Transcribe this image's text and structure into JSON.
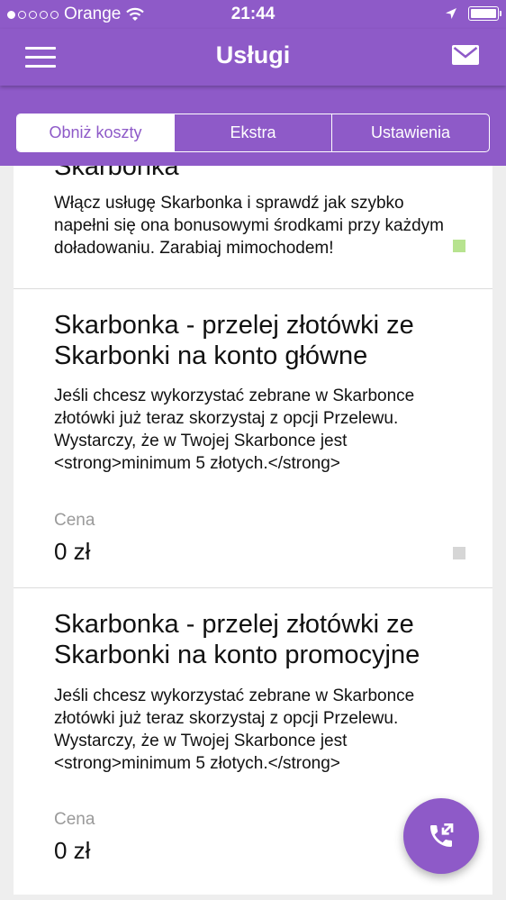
{
  "status_bar": {
    "carrier": "Orange",
    "time": "21:44"
  },
  "header": {
    "title": "Usługi",
    "menu_icon": "hamburger-icon",
    "mail_icon": "envelope-icon"
  },
  "tabs": [
    {
      "label": "Obniż koszty",
      "active": true
    },
    {
      "label": "Ekstra",
      "active": false
    },
    {
      "label": "Ustawienia",
      "active": false
    }
  ],
  "cards": [
    {
      "title": "Skarbonka",
      "description": "Włącz usługę Skarbonka i sprawdź jak szybko napełni się ona bonusowymi środkami przy każdym doładowaniu. Zarabiaj mimochodem!",
      "indicator_color": "#b7e38f"
    },
    {
      "title": "Skarbonka - przelej złotówki ze Skarbonki na konto główne",
      "description": "Jeśli chcesz wykorzystać zebrane w Skarbonce złotówki już teraz skorzystaj z opcji Przelewu. Wystarczy, że w Twojej Skarbonce jest <strong>minimum 5 złotych.</strong>",
      "price_label": "Cena",
      "price_value": "0 zł",
      "indicator_color": "#d6d6d6"
    },
    {
      "title": "Skarbonka - przelej złotówki ze Skarbonki na konto promocyjne",
      "description": "Jeśli chcesz wykorzystać zebrane w Skarbonce złotówki już teraz skorzystaj z opcji Przelewu. Wystarczy, że w Twojej Skarbonce jest <strong>minimum 5 złotych.</strong>",
      "price_label": "Cena",
      "price_value": "0 zł"
    }
  ],
  "fab": {
    "icon": "phone-transfer-icon"
  },
  "colors": {
    "brand": "#8e5ac8",
    "background": "#eeeeee"
  }
}
